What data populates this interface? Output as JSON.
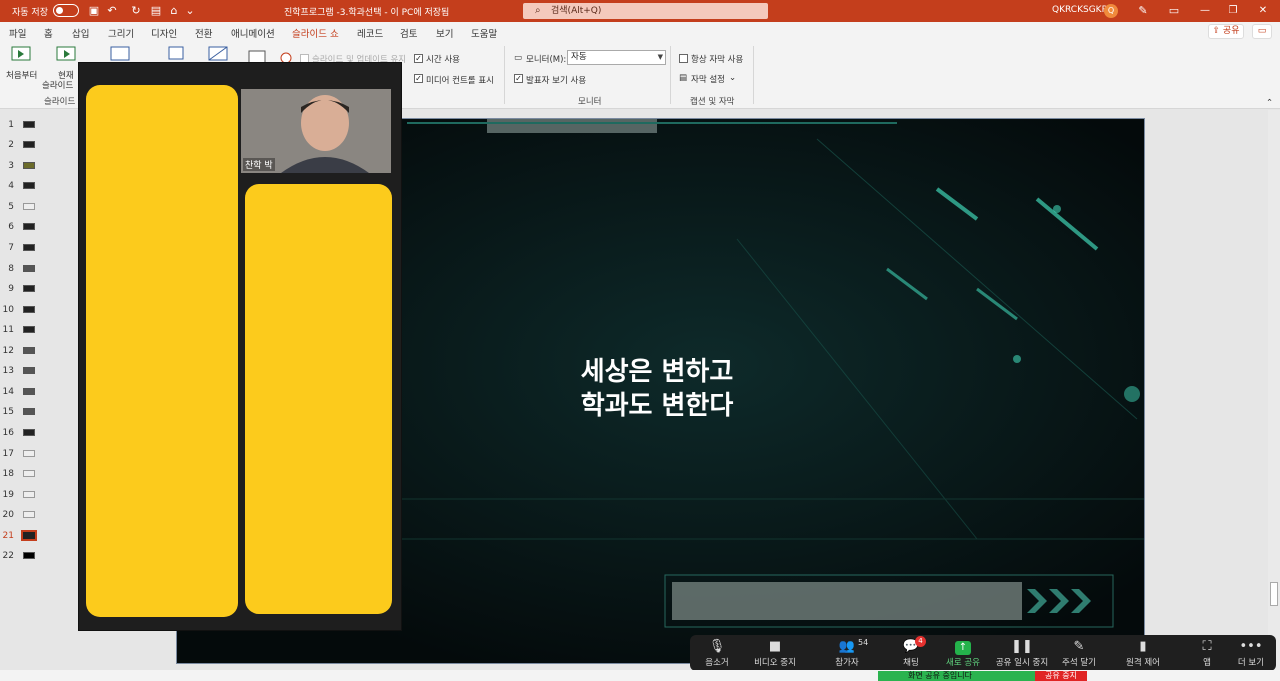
{
  "titlebar": {
    "autosave_label": "자동 저장",
    "doc_title": "진학프로그램 -3.학과선택 - 이 PC에 저장됨",
    "search_placeholder": "검색(Alt+Q)",
    "user_name": "QKRCKSGKR",
    "user_initial": "Q"
  },
  "menu": {
    "items": [
      "파일",
      "홈",
      "삽입",
      "그리기",
      "디자인",
      "전환",
      "애니메이션",
      "슬라이드 쇼",
      "레코드",
      "검토",
      "보기",
      "도움말"
    ],
    "active": "슬라이드 쇼",
    "share_label": "공유"
  },
  "ribbon": {
    "from_start_label": "처음부터",
    "from_current_label_1": "현재",
    "from_current_label_2": "슬라이드",
    "group_start_label": "슬라이드",
    "update_slides_label": "슬라이드 및 업데이트 유지",
    "use_timings_label": "시간 사용",
    "show_media_controls_label": "미디어 컨트롤 표시",
    "monitor_label": "모니터(M):",
    "monitor_value": "자동",
    "presenter_view_label": "발표자 보기 사용",
    "group_monitor_label": "모니터",
    "always_subtitles_label": "항상 자막 사용",
    "subtitle_settings_label": "자막 설정",
    "group_captions_label": "캡션 및 자막"
  },
  "thumbnails": {
    "numbers": [
      "1",
      "2",
      "3",
      "4",
      "5",
      "6",
      "7",
      "8",
      "9",
      "10",
      "11",
      "12",
      "13",
      "14",
      "15",
      "16",
      "17",
      "18",
      "19",
      "20",
      "21",
      "22"
    ],
    "selected": "21"
  },
  "slide": {
    "line1": "세상은 변하고",
    "line2": "학과도 변한다"
  },
  "zoom_panel": {
    "participant_name": "찬학 박"
  },
  "zoom_toolbar": {
    "mute_label": "음소거",
    "video_label": "비디오 중지",
    "participants_label": "참가자",
    "participants_count": "54",
    "chat_label": "채팅",
    "chat_badge": "4",
    "new_share_label": "새로 공유",
    "pause_share_label": "공유 일시 중지",
    "annotate_label": "주석 달기",
    "remote_control_label": "원격 제어",
    "apps_label": "앱",
    "more_label": "더 보기"
  },
  "share_status": {
    "sharing_label": "화면 공유 중입니다",
    "stop_label": "공유 중지"
  },
  "colors": {
    "ppt_accent": "#c43e1c",
    "yellow_box": "#fccb1c",
    "zoom_green": "#24b24b",
    "stop_red": "#e02424"
  }
}
